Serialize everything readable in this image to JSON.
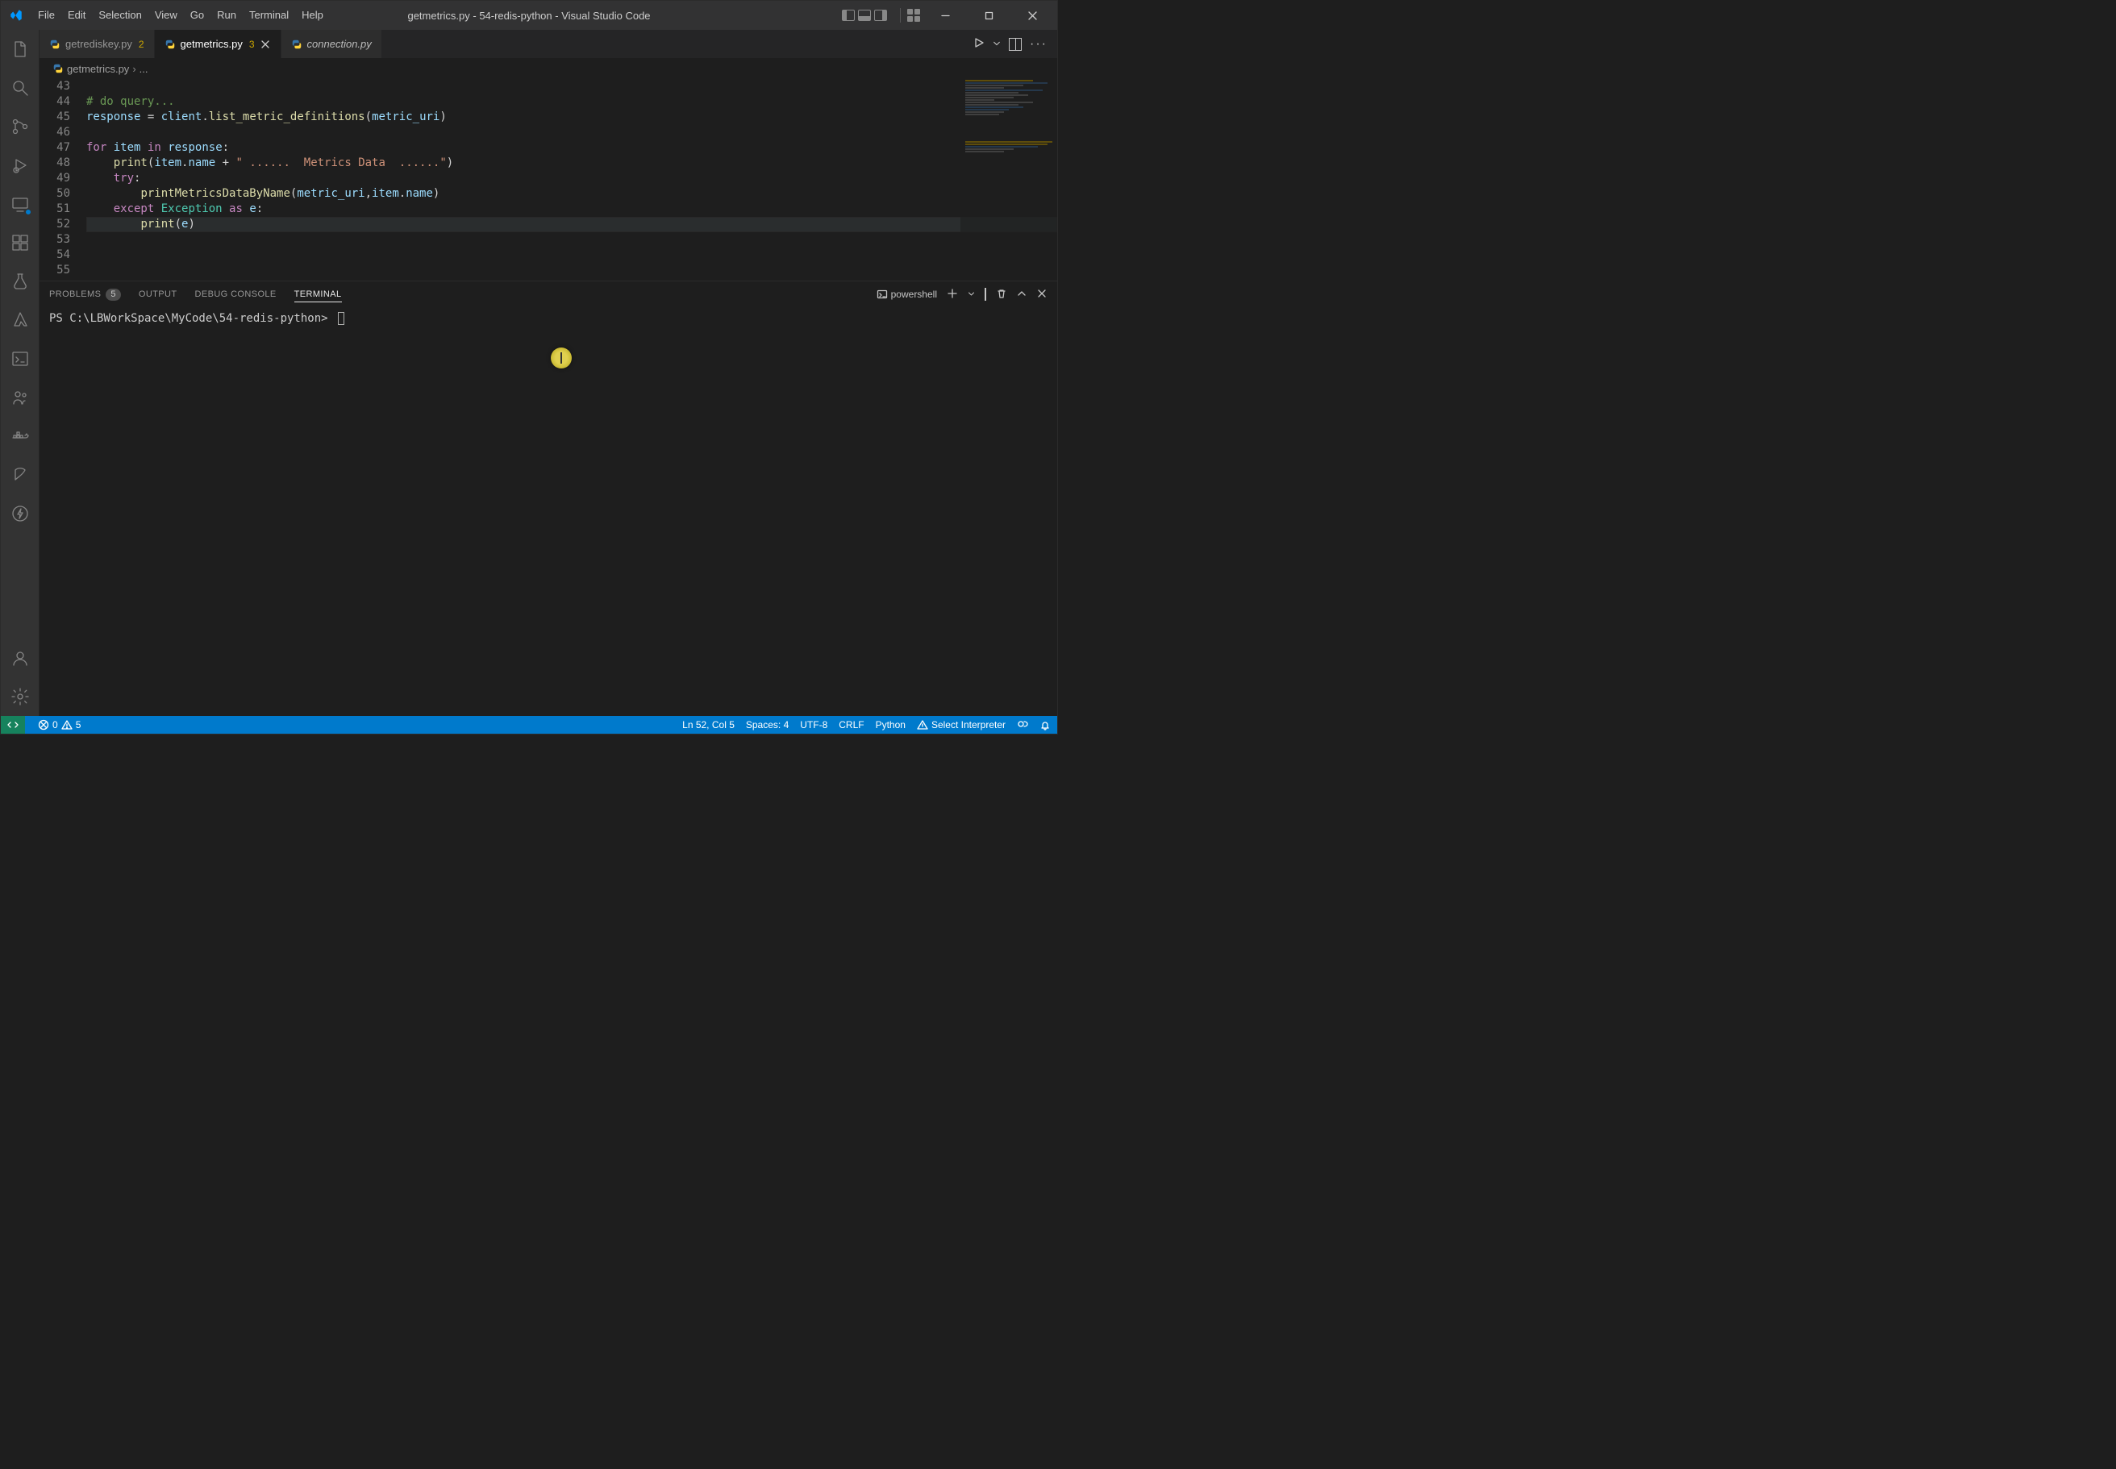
{
  "window": {
    "title": "getmetrics.py - 54-redis-python - Visual Studio Code"
  },
  "menu": {
    "file": "File",
    "edit": "Edit",
    "selection": "Selection",
    "view": "View",
    "go": "Go",
    "run": "Run",
    "terminal": "Terminal",
    "help": "Help"
  },
  "tabs": [
    {
      "name": "getrediskey.py",
      "badge": "2"
    },
    {
      "name": "getmetrics.py",
      "badge": "3"
    },
    {
      "name": "connection.py",
      "badge": ""
    }
  ],
  "breadcrumb": {
    "file": "getmetrics.py",
    "more": "..."
  },
  "code": {
    "lines": [
      {
        "num": "43",
        "segs": []
      },
      {
        "num": "44",
        "segs": [
          {
            "cls": "c-comment",
            "txt": "# do query..."
          }
        ]
      },
      {
        "num": "45",
        "segs": [
          {
            "cls": "c-var",
            "txt": "response"
          },
          {
            "cls": "c-plain",
            "txt": " = "
          },
          {
            "cls": "c-var",
            "txt": "client"
          },
          {
            "cls": "c-plain",
            "txt": "."
          },
          {
            "cls": "c-func",
            "txt": "list_metric_definitions"
          },
          {
            "cls": "c-plain",
            "txt": "("
          },
          {
            "cls": "c-var",
            "txt": "metric_uri"
          },
          {
            "cls": "c-plain",
            "txt": ")"
          }
        ]
      },
      {
        "num": "46",
        "segs": []
      },
      {
        "num": "47",
        "segs": [
          {
            "cls": "c-kw",
            "txt": "for"
          },
          {
            "cls": "c-plain",
            "txt": " "
          },
          {
            "cls": "c-var",
            "txt": "item"
          },
          {
            "cls": "c-plain",
            "txt": " "
          },
          {
            "cls": "c-kw",
            "txt": "in"
          },
          {
            "cls": "c-plain",
            "txt": " "
          },
          {
            "cls": "c-var",
            "txt": "response"
          },
          {
            "cls": "c-plain",
            "txt": ":"
          }
        ]
      },
      {
        "num": "48",
        "segs": [
          {
            "cls": "c-plain",
            "txt": "    "
          },
          {
            "cls": "c-func",
            "txt": "print"
          },
          {
            "cls": "c-plain",
            "txt": "("
          },
          {
            "cls": "c-var",
            "txt": "item"
          },
          {
            "cls": "c-plain",
            "txt": "."
          },
          {
            "cls": "c-var",
            "txt": "name"
          },
          {
            "cls": "c-plain",
            "txt": " + "
          },
          {
            "cls": "c-str",
            "txt": "\" ......  Metrics Data  ......\""
          },
          {
            "cls": "c-plain",
            "txt": ")"
          }
        ]
      },
      {
        "num": "49",
        "segs": [
          {
            "cls": "c-plain",
            "txt": "    "
          },
          {
            "cls": "c-kw",
            "txt": "try"
          },
          {
            "cls": "c-plain",
            "txt": ":"
          }
        ]
      },
      {
        "num": "50",
        "segs": [
          {
            "cls": "c-plain",
            "txt": "        "
          },
          {
            "cls": "c-func",
            "txt": "printMetricsDataByName"
          },
          {
            "cls": "c-plain",
            "txt": "("
          },
          {
            "cls": "c-var",
            "txt": "metric_uri"
          },
          {
            "cls": "c-plain",
            "txt": ","
          },
          {
            "cls": "c-var",
            "txt": "item"
          },
          {
            "cls": "c-plain",
            "txt": "."
          },
          {
            "cls": "c-var",
            "txt": "name"
          },
          {
            "cls": "c-plain",
            "txt": ")"
          }
        ]
      },
      {
        "num": "51",
        "segs": [
          {
            "cls": "c-plain",
            "txt": "    "
          },
          {
            "cls": "c-kw",
            "txt": "except"
          },
          {
            "cls": "c-plain",
            "txt": " "
          },
          {
            "cls": "c-class",
            "txt": "Exception"
          },
          {
            "cls": "c-plain",
            "txt": " "
          },
          {
            "cls": "c-kw",
            "txt": "as"
          },
          {
            "cls": "c-plain",
            "txt": " "
          },
          {
            "cls": "c-var",
            "txt": "e"
          },
          {
            "cls": "c-plain",
            "txt": ":"
          }
        ]
      },
      {
        "num": "52",
        "segs": [
          {
            "cls": "c-plain",
            "txt": "        "
          },
          {
            "cls": "c-func",
            "txt": "print"
          },
          {
            "cls": "c-plain",
            "txt": "("
          },
          {
            "cls": "c-var",
            "txt": "e"
          },
          {
            "cls": "c-plain",
            "txt": ")"
          }
        ],
        "current": true
      },
      {
        "num": "53",
        "segs": []
      },
      {
        "num": "54",
        "segs": []
      },
      {
        "num": "55",
        "segs": []
      }
    ]
  },
  "panel": {
    "problems": "PROBLEMS",
    "problems_count": "5",
    "output": "OUTPUT",
    "debug": "DEBUG CONSOLE",
    "terminal": "TERMINAL",
    "shell": "powershell"
  },
  "terminal": {
    "prompt": "PS C:\\LBWorkSpace\\MyCode\\54-redis-python> "
  },
  "status": {
    "errors": "0",
    "warnings": "5",
    "cursor": "Ln 52, Col 5",
    "spaces": "Spaces: 4",
    "encoding": "UTF-8",
    "eol": "CRLF",
    "language": "Python",
    "interpreter": "Select Interpreter"
  }
}
